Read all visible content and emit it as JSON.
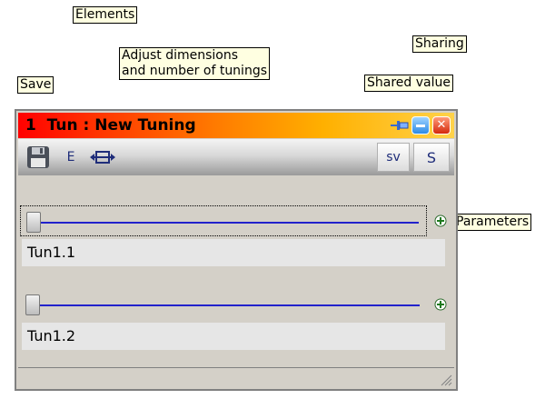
{
  "callouts": {
    "elements": "Elements",
    "adjust": "Adjust dimensions\nand number of tunings",
    "sharing": "Sharing",
    "save": "Save",
    "shared_value": "Shared value",
    "parameters": "Parameters"
  },
  "window": {
    "title": "1  Tun : New Tuning",
    "close_glyph": "✕"
  },
  "toolbar": {
    "e_label": "E",
    "sv_label": "sv",
    "s_label": "S"
  },
  "tunings": [
    {
      "label": "Tun1.1",
      "value": 0
    },
    {
      "label": "Tun1.2",
      "value": 0
    }
  ],
  "icons": {
    "save": "floppy-disk-icon",
    "adjust": "resize-horizontal-icon",
    "pin": "pin-icon",
    "minimize": "minimize-icon",
    "close": "close-icon",
    "add": "plus-icon",
    "grip": "resize-grip-icon"
  },
  "colors": {
    "title_gradient_start": "#ff0000",
    "title_gradient_end": "#ffd24a",
    "slider_track": "#2222cc",
    "callout_bg": "#ffffe1"
  }
}
